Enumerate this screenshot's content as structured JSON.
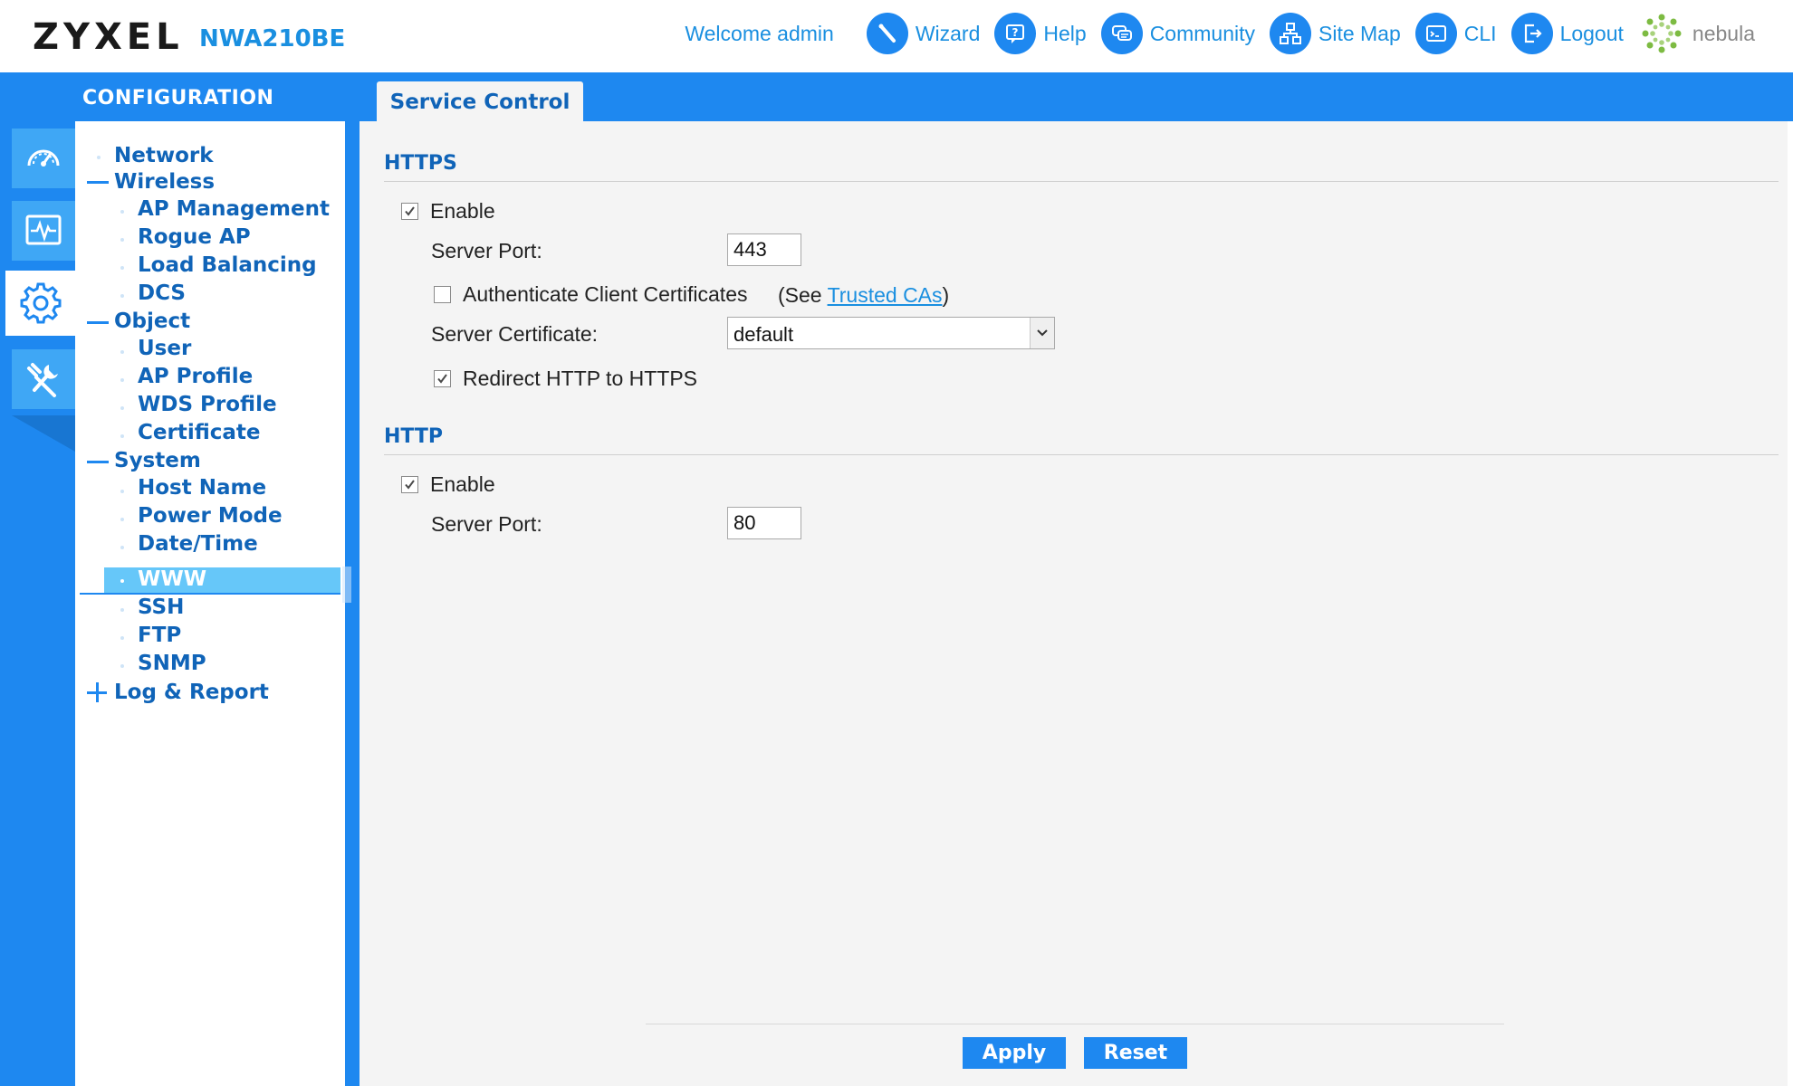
{
  "header": {
    "logo": "ZYXEL",
    "model": "NWA210BE",
    "welcome": "Welcome admin",
    "nav": [
      {
        "label": "Wizard",
        "icon": "wizard-wand-icon"
      },
      {
        "label": "Help",
        "icon": "help-icon"
      },
      {
        "label": "Community",
        "icon": "community-chat-icon"
      },
      {
        "label": "Site Map",
        "icon": "site-map-icon"
      },
      {
        "label": "CLI",
        "icon": "cli-terminal-icon"
      },
      {
        "label": "Logout",
        "icon": "logout-icon"
      },
      {
        "label": "nebula",
        "icon": "nebula-logo-icon"
      }
    ]
  },
  "sidebar": {
    "title": "CONFIGURATION",
    "rail": [
      {
        "icon": "dashboard-gauge-icon",
        "active": false
      },
      {
        "icon": "monitor-pulse-icon",
        "active": false
      },
      {
        "icon": "configuration-gear-icon",
        "active": true
      },
      {
        "icon": "maintenance-tools-icon",
        "active": false
      }
    ],
    "tree": {
      "network": "Network",
      "wireless": "Wireless",
      "ap_management": "AP Management",
      "rogue_ap": "Rogue AP",
      "load_balancing": "Load Balancing",
      "dcs": "DCS",
      "object": "Object",
      "user": "User",
      "ap_profile": "AP Profile",
      "wds_profile": "WDS Profile",
      "certificate": "Certificate",
      "system": "System",
      "host_name": "Host Name",
      "power_mode": "Power Mode",
      "date_time": "Date/Time",
      "www": "WWW",
      "ssh": "SSH",
      "ftp": "FTP",
      "snmp": "SNMP",
      "log_report": "Log & Report"
    },
    "selected": "WWW"
  },
  "tab": {
    "label": "Service Control"
  },
  "https": {
    "title": "HTTPS",
    "enable_label": "Enable",
    "enable_checked": true,
    "server_port_label": "Server Port:",
    "server_port_value": "443",
    "auth_client_label": "Authenticate Client Certificates",
    "auth_client_checked": false,
    "see_prefix": "(See ",
    "trusted_cas_link": "Trusted CAs",
    "see_suffix": ")",
    "server_cert_label": "Server Certificate:",
    "server_cert_value": "default",
    "redirect_label": "Redirect HTTP to HTTPS",
    "redirect_checked": true
  },
  "http": {
    "title": "HTTP",
    "enable_label": "Enable",
    "enable_checked": true,
    "server_port_label": "Server Port:",
    "server_port_value": "80"
  },
  "actions": {
    "apply_label": "Apply",
    "reset_label": "Reset"
  },
  "colors": {
    "brand_blue": "#1e88f0",
    "nav_text": "#1a8fe0",
    "tree_text": "#1064b8",
    "selected_bg": "#66c7f9",
    "content_bg": "#f4f4f4"
  }
}
